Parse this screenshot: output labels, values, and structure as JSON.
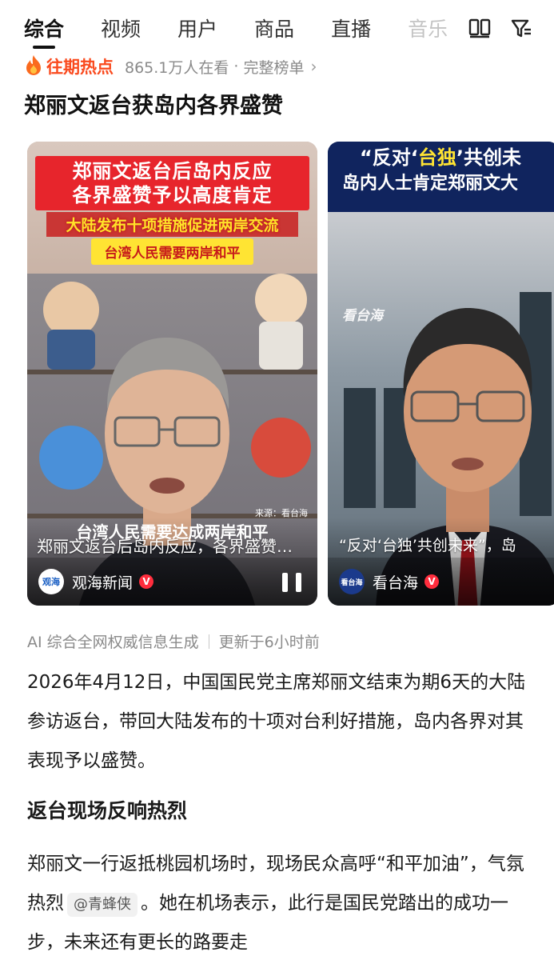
{
  "tabs": {
    "items": [
      "综合",
      "视频",
      "用户",
      "商品",
      "直播",
      "音乐"
    ],
    "active_index": 0
  },
  "toolbar": {
    "icons": [
      "layout-icon",
      "filter-icon"
    ]
  },
  "hot": {
    "badge": "往期热点",
    "viewers": "865.1万人在看",
    "separator": "·",
    "full_list": "完整榜单",
    "color": "#fa4a1e"
  },
  "headline": "郑丽文返台获岛内各界盛赞",
  "videos": [
    {
      "title_line1": "郑丽文返台后岛内反应",
      "title_line2": "各界盛赞予以高度肯定",
      "subtitle": "大陆发布十项措施促进两岸交流",
      "tag": "台湾人民需要两岸和平",
      "source": "来源：看台海",
      "caption": "台湾人民需要达成两岸和平",
      "description": "郑丽文返台后岛内反应，各界盛赞予以高度肯定",
      "channel": "观海新闻",
      "channel_logo": "观海",
      "verified": "V"
    },
    {
      "title_line1_a": "“反对‘",
      "title_line1_b": "台独",
      "title_line1_c": "’共创未",
      "title_line2": "岛内人士肯定郑丽文大",
      "watermark": "看台海",
      "description": "“反对‘台独’共创未来”，岛",
      "channel": "看台海",
      "channel_logo": "看台海",
      "verified": "V"
    }
  ],
  "article": {
    "source_note": "AI 综合全网权威信息生成",
    "updated": "更新于6小时前",
    "paragraph1": "2026年4月12日，中国国民党主席郑丽文结束为期6天的大陆参访返台，带回大陆发布的十项对台利好措施，岛内各界对其表现予以盛赞。",
    "section_heading": "返台现场反响热烈",
    "paragraph2_a": "郑丽文一行返抵桃园机场时，现场民众高呼“和平加油”，气氛热烈",
    "mention": "@青蜂侠",
    "paragraph2_b": "。她在机场表示，此行是国民党踏出的成功一步，未来还有更长的路要走"
  }
}
